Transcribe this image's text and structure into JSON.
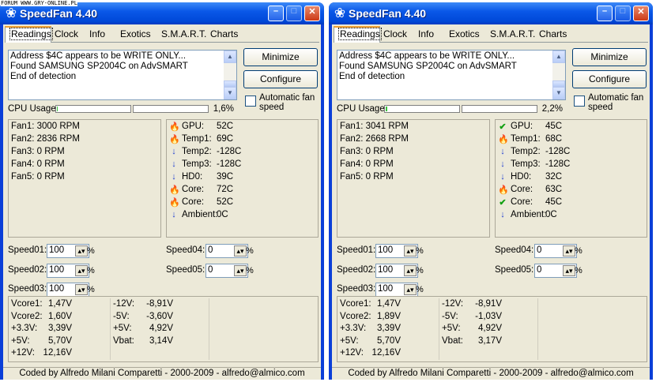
{
  "watermark": "FORUM WWW.GRY-ONLINE.PL",
  "app": {
    "title": "SpeedFan 4.40"
  },
  "tabs": [
    "Readings",
    "Clock",
    "Info",
    "Exotics",
    "S.M.A.R.T.",
    "Charts"
  ],
  "buttons": {
    "minimize": "Minimize",
    "configure": "Configure"
  },
  "auto_fan_label": "Automatic fan speed",
  "cpu_usage_label": "CPU Usage",
  "footer": "Coded by Alfredo Milani Comparetti - 2000-2009 - alfredo@almico.com",
  "speed_unit": "%",
  "windows": [
    {
      "log": [
        "Address $4C appears to be WRITE ONLY...",
        "Found SAMSUNG SP2004C on AdvSMART",
        "End of detection"
      ],
      "cpu_usage": {
        "text": "1,6%",
        "fraction": 0.016
      },
      "fans": [
        "Fan1: 3000 RPM",
        "Fan2: 2836 RPM",
        "Fan3: 0 RPM",
        "Fan4: 0 RPM",
        "Fan5: 0 RPM"
      ],
      "temps": [
        {
          "icon": "fire-icon",
          "name": "GPU:",
          "value": "52C"
        },
        {
          "icon": "fire-icon",
          "name": "Temp1:",
          "value": "69C"
        },
        {
          "icon": "arrow-down-icon",
          "name": "Temp2:",
          "value": "-128C"
        },
        {
          "icon": "arrow-down-icon",
          "name": "Temp3:",
          "value": "-128C"
        },
        {
          "icon": "arrow-down-icon",
          "name": "HD0:",
          "value": "39C"
        },
        {
          "icon": "fire-icon",
          "name": "Core:",
          "value": "72C"
        },
        {
          "icon": "fire-icon",
          "name": "Core:",
          "value": "52C"
        },
        {
          "icon": "arrow-down-icon",
          "name": "Ambient:",
          "value": "0C"
        }
      ],
      "speeds": [
        {
          "label": "Speed01:",
          "value": "100"
        },
        {
          "label": "Speed02:",
          "value": "100"
        },
        {
          "label": "Speed03:",
          "value": "100"
        },
        {
          "label": "Speed04:",
          "value": "0"
        },
        {
          "label": "Speed05:",
          "value": "0"
        }
      ],
      "volts_col1": [
        {
          "name": "Vcore1:",
          "value": "1,47V"
        },
        {
          "name": "Vcore2:",
          "value": "1,60V"
        },
        {
          "name": "+3.3V:",
          "value": "3,39V"
        },
        {
          "name": "+5V:",
          "value": "5,70V"
        },
        {
          "name": "+12V:",
          "value": "12,16V"
        }
      ],
      "volts_col2": [
        {
          "name": "-12V:",
          "value": "-8,91V"
        },
        {
          "name": "-5V:",
          "value": "-3,60V"
        },
        {
          "name": "+5V:",
          "value": "4,92V"
        },
        {
          "name": "Vbat:",
          "value": "3,14V"
        }
      ]
    },
    {
      "log": [
        "Address $4C appears to be WRITE ONLY...",
        "Found SAMSUNG SP2004C on AdvSMART",
        "End of detection"
      ],
      "cpu_usage": {
        "text": "2,2%",
        "fraction": 0.022
      },
      "fans": [
        "Fan1: 3041 RPM",
        "Fan2: 2668 RPM",
        "Fan3: 0 RPM",
        "Fan4: 0 RPM",
        "Fan5: 0 RPM"
      ],
      "temps": [
        {
          "icon": "check-icon",
          "name": "GPU:",
          "value": "45C"
        },
        {
          "icon": "fire-icon",
          "name": "Temp1:",
          "value": "68C"
        },
        {
          "icon": "arrow-down-icon",
          "name": "Temp2:",
          "value": "-128C"
        },
        {
          "icon": "arrow-down-icon",
          "name": "Temp3:",
          "value": "-128C"
        },
        {
          "icon": "arrow-down-icon",
          "name": "HD0:",
          "value": "32C"
        },
        {
          "icon": "fire-icon",
          "name": "Core:",
          "value": "63C"
        },
        {
          "icon": "check-icon",
          "name": "Core:",
          "value": "45C"
        },
        {
          "icon": "arrow-down-icon",
          "name": "Ambient:",
          "value": "0C"
        }
      ],
      "speeds": [
        {
          "label": "Speed01:",
          "value": "100"
        },
        {
          "label": "Speed02:",
          "value": "100"
        },
        {
          "label": "Speed03:",
          "value": "100"
        },
        {
          "label": "Speed04:",
          "value": "0"
        },
        {
          "label": "Speed05:",
          "value": "0"
        }
      ],
      "volts_col1": [
        {
          "name": "Vcore1:",
          "value": "1,47V"
        },
        {
          "name": "Vcore2:",
          "value": "1,89V"
        },
        {
          "name": "+3.3V:",
          "value": "3,39V"
        },
        {
          "name": "+5V:",
          "value": "5,70V"
        },
        {
          "name": "+12V:",
          "value": "12,16V"
        }
      ],
      "volts_col2": [
        {
          "name": "-12V:",
          "value": "-8,91V"
        },
        {
          "name": "-5V:",
          "value": "-1,03V"
        },
        {
          "name": "+5V:",
          "value": "4,92V"
        },
        {
          "name": "Vbat:",
          "value": "3,17V"
        }
      ]
    }
  ]
}
